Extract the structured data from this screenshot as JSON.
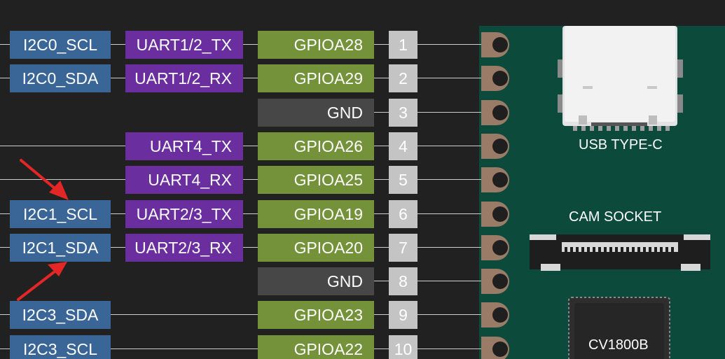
{
  "colors": {
    "background": "#212121",
    "i2c": "#3a6597",
    "uart": "#6a2e9e",
    "gpio": "#74923a",
    "gnd": "#474747",
    "pin_number": "#c4c4c4",
    "board": "#0c4a3c",
    "pad": "#9a7b68",
    "arrow": "#e32626"
  },
  "pins": [
    {
      "number": "1",
      "gpio": "GPIOA28",
      "uart": "UART1/2_TX",
      "i2c": "I2C0_SCL"
    },
    {
      "number": "2",
      "gpio": "GPIOA29",
      "uart": "UART1/2_RX",
      "i2c": "I2C0_SDA"
    },
    {
      "number": "3",
      "gpio": "GND",
      "uart": "",
      "i2c": ""
    },
    {
      "number": "4",
      "gpio": "GPIOA26",
      "uart": "UART4_TX",
      "i2c": ""
    },
    {
      "number": "5",
      "gpio": "GPIOA25",
      "uart": "UART4_RX",
      "i2c": ""
    },
    {
      "number": "6",
      "gpio": "GPIOA19",
      "uart": "UART2/3_TX",
      "i2c": "I2C1_SCL"
    },
    {
      "number": "7",
      "gpio": "GPIOA20",
      "uart": "UART2/3_RX",
      "i2c": "I2C1_SDA"
    },
    {
      "number": "8",
      "gpio": "GND",
      "uart": "",
      "i2c": ""
    },
    {
      "number": "9",
      "gpio": "GPIOA23",
      "uart": "",
      "i2c": "I2C3_SDA"
    },
    {
      "number": "10",
      "gpio": "GPIOA22",
      "uart": "",
      "i2c": "I2C3_SCL"
    }
  ],
  "board": {
    "usb_label": "USB TYPE-C",
    "cam_label": "CAM SOCKET",
    "chip_label": "CV1800B"
  },
  "annotations": [
    {
      "name": "arrow-to-i2c1-scl",
      "points_to": "I2C1_SCL"
    },
    {
      "name": "arrow-to-i2c1-sda",
      "points_to": "I2C1_SDA"
    }
  ]
}
